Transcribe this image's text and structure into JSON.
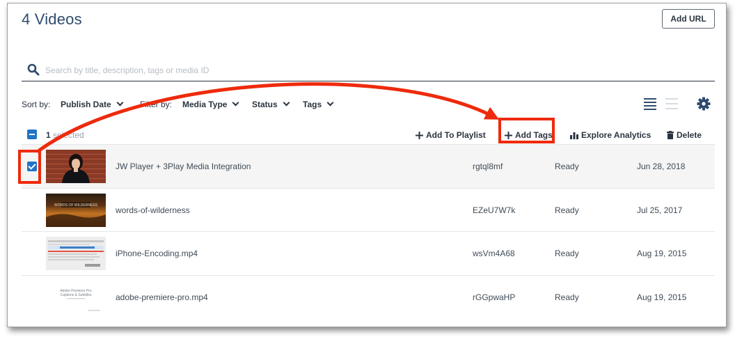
{
  "header": {
    "title": "4 Videos",
    "add_url_label": "Add URL"
  },
  "search": {
    "placeholder": "Search by title, description, tags or media ID"
  },
  "filters": {
    "sort_label": "Sort by:",
    "sort_value": "Publish Date",
    "filter_label": "Filter by:",
    "media_type": "Media Type",
    "status": "Status",
    "tags": "Tags"
  },
  "bulk": {
    "count": "1",
    "selected_word": "selected",
    "add_to_playlist": "Add To Playlist",
    "add_tags": "Add Tags",
    "explore_analytics": "Explore Analytics",
    "delete": "Delete"
  },
  "videos": [
    {
      "title": "JW Player + 3Play Media Integration",
      "media_id": "rgtql8mf",
      "status": "Ready",
      "date": "Jun 28, 2018",
      "selected": true,
      "thumb": "person-brick-wall"
    },
    {
      "title": "words-of-wilderness",
      "media_id": "EZeU7W7k",
      "status": "Ready",
      "date": "Jul 25, 2017",
      "selected": false,
      "thumb": "dark-landscape"
    },
    {
      "title": "iPhone-Encoding.mp4",
      "media_id": "wsVm4A68",
      "status": "Ready",
      "date": "Aug 19, 2015",
      "selected": false,
      "thumb": "spreadsheet-screen"
    },
    {
      "title": "adobe-premiere-pro.mp4",
      "media_id": "rGGpwaHP",
      "status": "Ready",
      "date": "Aug 19, 2015",
      "selected": false,
      "thumb": "title-card"
    }
  ],
  "thumb_text": {
    "wilderness": "WORDS OF WILDERNESS",
    "premiere_l1": "Adobe Premiere Pro",
    "premiere_l2": "Captions & Subtitles"
  },
  "colors": {
    "accent": "#1f74c8",
    "annotation": "#ee2a0c",
    "title": "#2f4c6e"
  }
}
